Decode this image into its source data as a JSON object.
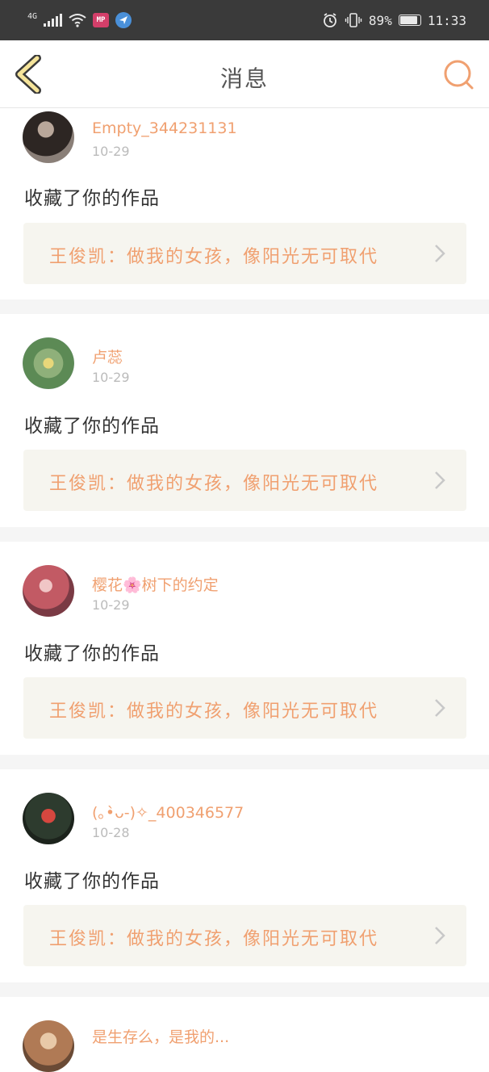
{
  "status_bar": {
    "network": "4G",
    "app_badge": "MP",
    "battery": "89%",
    "time": "11:33",
    "icons": [
      "signal-icon",
      "wifi-icon",
      "app-badge-icon",
      "navigation-icon",
      "alarm-icon",
      "vibrate-icon",
      "battery-icon"
    ]
  },
  "header": {
    "title": "消息",
    "back_icon": "chevron-left-icon",
    "search_icon": "search-icon",
    "accent_color": "#f0a070"
  },
  "messages": [
    {
      "username": "Empty_344231131",
      "date": "10-29",
      "action": "收藏了你的作品",
      "work_title": "王俊凯：做我的女孩，像阳光无可取代"
    },
    {
      "username": "卢蕊",
      "date": "10-29",
      "action": "收藏了你的作品",
      "work_title": "王俊凯：做我的女孩，像阳光无可取代"
    },
    {
      "username": "樱花🌸树下的约定",
      "date": "10-29",
      "action": "收藏了你的作品",
      "work_title": "王俊凯：做我的女孩，像阳光无可取代"
    },
    {
      "username": "(｡•̀ᴗ-)✧_400346577",
      "date": "10-28",
      "action": "收藏了你的作品",
      "work_title": "王俊凯：做我的女孩，像阳光无可取代"
    },
    {
      "username": "是生存么，是我的..."
    }
  ]
}
